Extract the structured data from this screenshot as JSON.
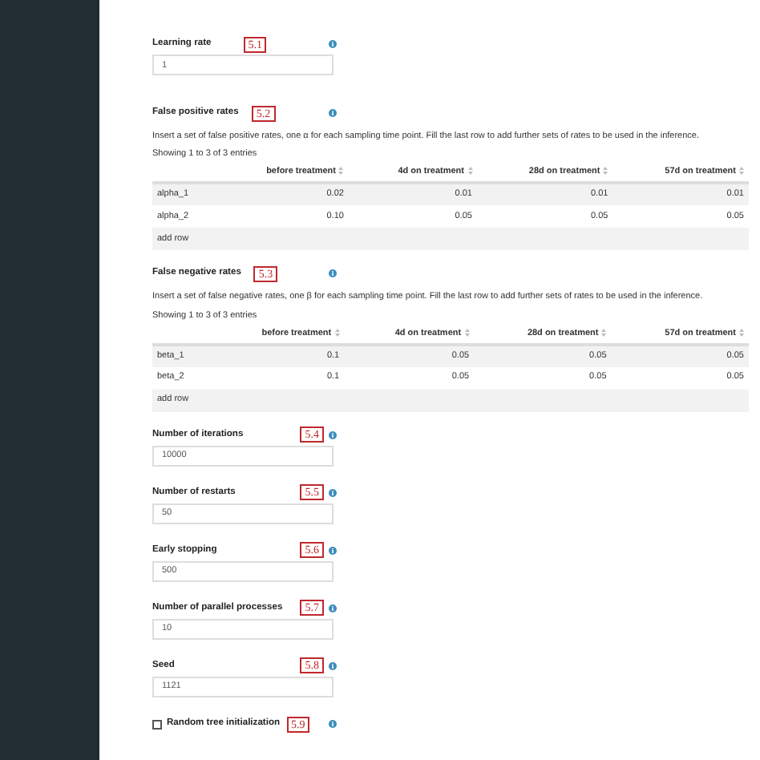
{
  "sections": [
    {
      "kind": "field",
      "label": "Learning rate",
      "tag": "5.1",
      "value": "1"
    },
    {
      "kind": "table",
      "label": "False positive rates",
      "tag": "5.2",
      "description": "Insert a set of false positive rates, one α for each sampling time point. Fill the last row to add further sets of rates to be used in the inference.",
      "info": "Showing 1 to 3 of 3 entries",
      "columns": [
        "",
        "before treatment",
        "4d on treatment",
        "28d on treatment",
        "57d on treatment"
      ],
      "rows": [
        [
          "alpha_1",
          "0.02",
          "0.01",
          "0.01",
          "0.01"
        ],
        [
          "alpha_2",
          "0.10",
          "0.05",
          "0.05",
          "0.05"
        ]
      ],
      "add_row": "add row"
    },
    {
      "kind": "table",
      "label": "False negative rates",
      "tag": "5.3",
      "description": "Insert a set of false negative rates, one β for each sampling time point. Fill the last row to add further sets of rates to be used in the inference.",
      "info": "Showing 1 to 3 of 3 entries",
      "columns": [
        "",
        "before treatment",
        "4d on treatment",
        "28d on treatment",
        "57d on treatment"
      ],
      "rows": [
        [
          "beta_1",
          "0.1",
          "0.05",
          "0.05",
          "0.05"
        ],
        [
          "beta_2",
          "0.1",
          "0.05",
          "0.05",
          "0.05"
        ]
      ],
      "add_row": "add row"
    },
    {
      "kind": "field",
      "label": "Number of iterations",
      "tag": "5.4",
      "value": "10000"
    },
    {
      "kind": "field",
      "label": "Number of restarts",
      "tag": "5.5",
      "value": "50"
    },
    {
      "kind": "field",
      "label": "Early stopping",
      "tag": "5.6",
      "value": "500"
    },
    {
      "kind": "field",
      "label": "Number of parallel processes",
      "tag": "5.7",
      "value": "10"
    },
    {
      "kind": "field",
      "label": "Seed",
      "tag": "5.8",
      "value": "1121"
    },
    {
      "kind": "checkbox",
      "label": "Random tree initialization",
      "tag": "5.9",
      "checked": false
    }
  ]
}
